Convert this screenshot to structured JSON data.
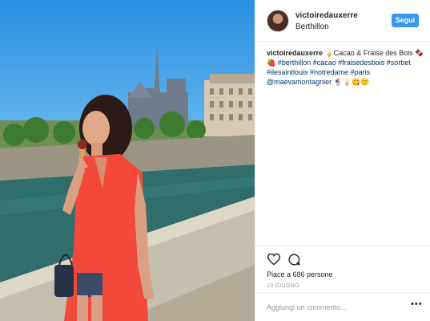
{
  "post": {
    "username": "victoiredauxerre",
    "location": "Berthillon",
    "follow_label": "Segui",
    "caption": {
      "username": "victoiredauxerre",
      "text": " 🍦Cacao & Fraise des Bois 🍫🍓 ",
      "hashtags": "#berthillon #cacao #fraisedesbois #sorbet #ilesaintlouis #notredame #paris",
      "mention": "@maevamontagnier",
      "emoji_tail": " 🍨🍦😋🙂"
    },
    "likes": "Piace a 686 persone",
    "date": "10 GIUGNO",
    "comment_placeholder": "Aggiungi un commento...",
    "more_label": "•••"
  },
  "icons": {
    "like": "heart-icon",
    "comment": "comment-icon",
    "more": "more-options-icon"
  },
  "colors": {
    "follow_button": "#3897f0",
    "hashtag": "#003569",
    "dress": "#f2493a",
    "sky": "#2a8fe0",
    "river": "#2f6e6a"
  }
}
